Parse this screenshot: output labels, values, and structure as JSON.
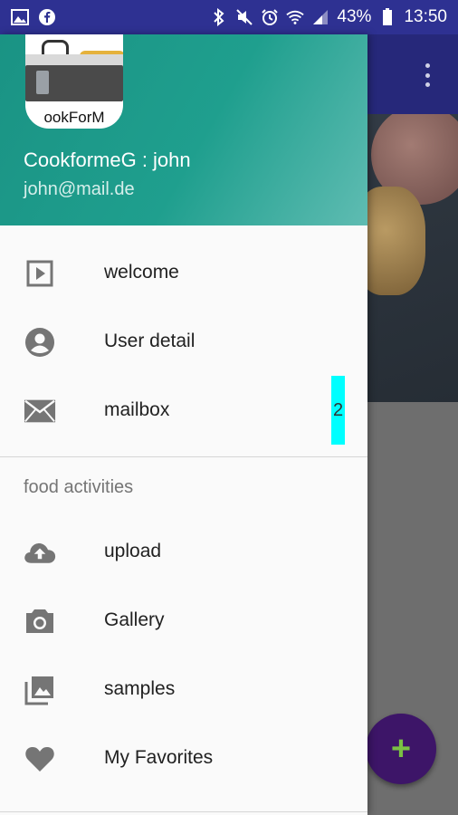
{
  "status_bar": {
    "battery_percent": "43%",
    "time": "13:50",
    "icons_left": [
      "image-icon",
      "facebook-icon"
    ],
    "icons_right": [
      "bluetooth-icon",
      "mute-icon",
      "alarm-icon",
      "wifi-icon",
      "signal-icon",
      "battery-icon"
    ]
  },
  "drawer": {
    "header": {
      "avatar_text": "ookForM",
      "user_name": "CookformeG : john",
      "user_email": "john@mail.de"
    },
    "items": [
      {
        "label": "welcome",
        "icon": "play-icon"
      },
      {
        "label": "User detail",
        "icon": "account-icon"
      },
      {
        "label": "mailbox",
        "icon": "mail-icon",
        "badge": "2"
      }
    ],
    "section": {
      "title": "food activities",
      "items": [
        {
          "label": "upload",
          "icon": "cloud-upload-icon"
        },
        {
          "label": "Gallery",
          "icon": "camera-icon"
        },
        {
          "label": "samples",
          "icon": "photo-library-icon"
        },
        {
          "label": "My Favorites",
          "icon": "heart-icon"
        }
      ]
    }
  },
  "fab": {
    "label": "+",
    "icon": "add-icon"
  },
  "colors": {
    "status_bar": "#2e3192",
    "header_teal": "#1a9384",
    "badge": "#00ffff",
    "fab": "#3d1568",
    "fab_plus": "#7ac143"
  }
}
